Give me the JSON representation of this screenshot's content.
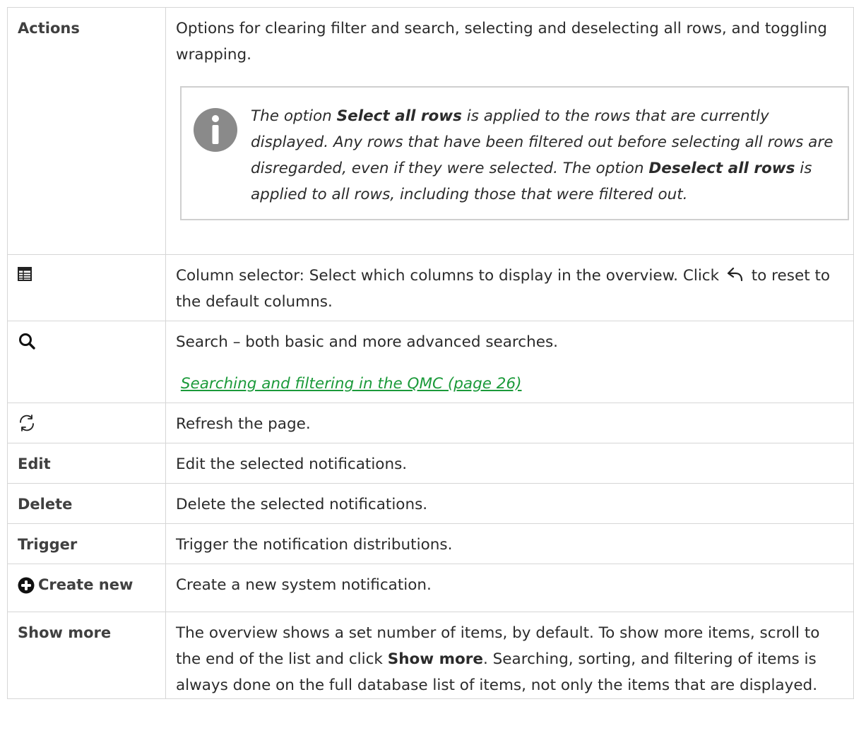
{
  "rows": {
    "actions": {
      "label": "Actions",
      "desc": "Options for clearing filter and search, selecting and deselecting all rows, and toggling wrapping.",
      "note": {
        "p1": "The option ",
        "b1": "Select all rows",
        "p2": " is applied to the rows that are currently displayed. Any rows that have been filtered out before selecting all rows are disregarded, even if they were selected. The option ",
        "b2": "Deselect all rows",
        "p3": " is applied to all rows, including those that were filtered out."
      },
      "note_icon": "info-icon"
    },
    "column_selector": {
      "icon": "table-icon",
      "desc_a": "Column selector: Select which columns to display in the overview. Click ",
      "reset_icon": "undo-arrow-icon",
      "desc_b": " to reset to the default columns."
    },
    "search": {
      "icon": "search-icon",
      "desc": "Search – both basic and more advanced searches.",
      "link": "Searching and filtering in the QMC (page 26)"
    },
    "refresh": {
      "icon": "refresh-icon",
      "desc": "Refresh the page."
    },
    "edit": {
      "label": "Edit",
      "desc": "Edit the selected notifications."
    },
    "delete": {
      "label": "Delete",
      "desc": "Delete the selected notifications."
    },
    "trigger": {
      "label": "Trigger",
      "desc": "Trigger the notification distributions."
    },
    "create_new": {
      "icon": "plus-circle-icon",
      "label": "Create new",
      "desc": "Create a new system notification."
    },
    "show_more": {
      "label": "Show more",
      "desc_a": "The overview shows a set number of items, by default. To show more items, scroll to the end of the list and click ",
      "desc_bold": "Show more",
      "desc_b": ". Searching, sorting, and filtering of items is always done on the full database list of items, not only the items that are displayed."
    }
  },
  "colors": {
    "link": "#1b9a3a",
    "border": "#d6d6d6",
    "note_border": "#cfcfcf",
    "info_icon": "#8a8a8a"
  }
}
